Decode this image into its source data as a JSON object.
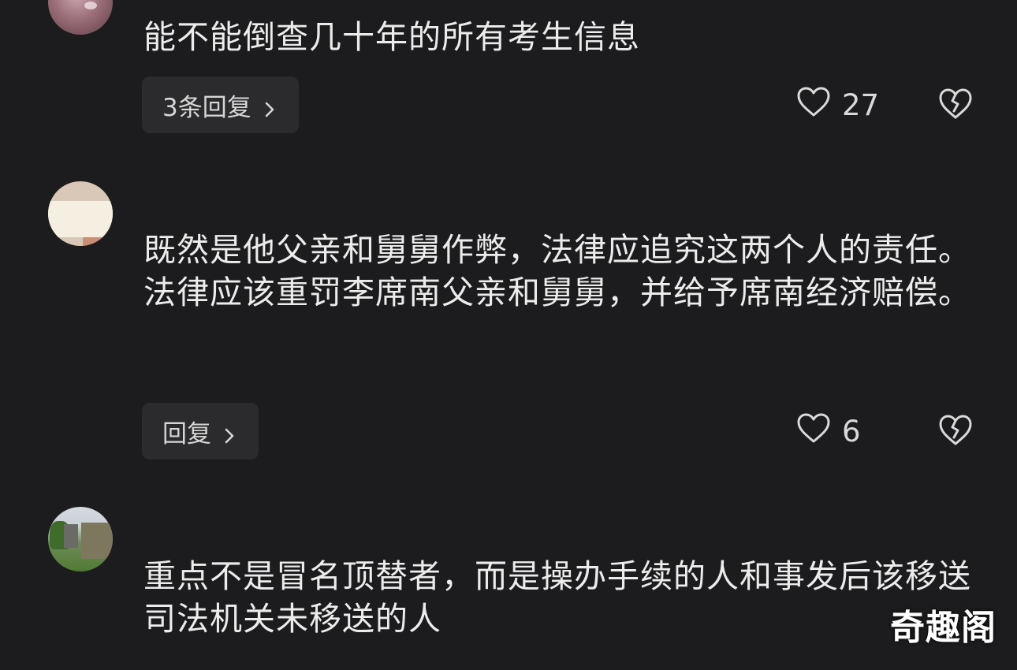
{
  "comments": [
    {
      "text": "能不能倒查几十年的所有考生信息",
      "reply_label": "3条回复",
      "like_count": "27"
    },
    {
      "text": "既然是他父亲和舅舅作弊，法律应追究这两个人的责任。法律应该重罚李席南父亲和舅舅，并给予席南经济赔偿。",
      "reply_label": "回复",
      "like_count": "6"
    },
    {
      "text": "重点不是冒名顶替者，而是操办手续的人和事发后该移送司法机关未移送的人"
    }
  ],
  "icons": {
    "like": "heart-outline-icon",
    "dislike": "broken-heart-icon",
    "chevron": "chevron-right-icon"
  },
  "watermark": "奇趣阁",
  "colors": {
    "background": "#1c1c1e",
    "text": "#ececec",
    "button_bg": "#2b2b2d"
  }
}
